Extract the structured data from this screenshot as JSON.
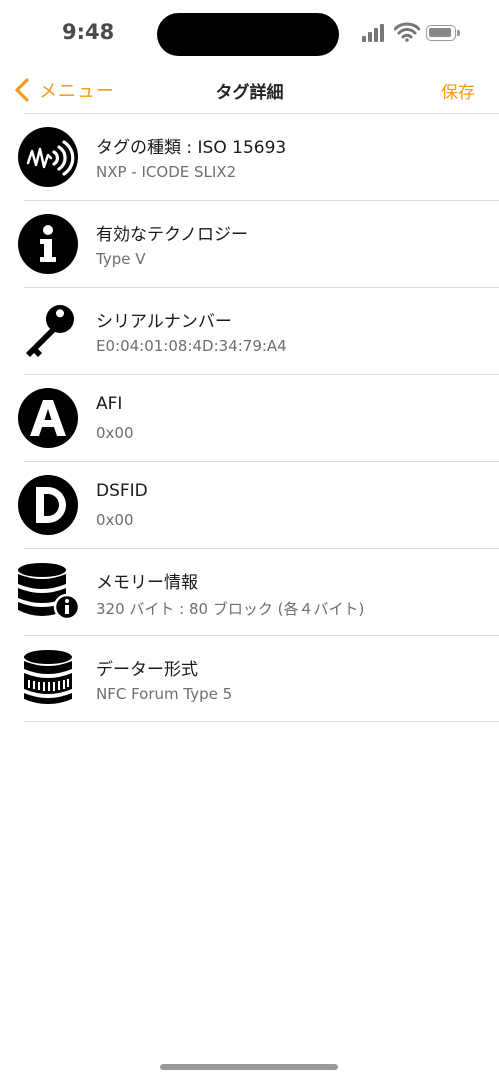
{
  "status_bar": {
    "time": "9:48"
  },
  "nav": {
    "back_label": "メニュー",
    "title": "タグ詳細",
    "save_label": "保存",
    "accent_color": "#f29a1a"
  },
  "rows": [
    {
      "icon": "nfc-signal-icon",
      "primary": "タグの種類 : ISO 15693",
      "secondary": "NXP - ICODE SLIX2"
    },
    {
      "icon": "info-icon",
      "primary": "有効なテクノロジー",
      "secondary": "Type V"
    },
    {
      "icon": "key-icon",
      "primary": "シリアルナンバー",
      "secondary": "E0:04:01:08:4D:34:79:A4"
    },
    {
      "icon": "letter-a-icon",
      "primary": "AFI",
      "secondary": "0x00"
    },
    {
      "icon": "letter-d-icon",
      "primary": "DSFID",
      "secondary": "0x00"
    },
    {
      "icon": "database-info-icon",
      "primary": "メモリー情報",
      "secondary": "320 バイト : 80 ブロック (各４バイト)"
    },
    {
      "icon": "database-icon",
      "primary": "データー形式",
      "secondary": "NFC Forum Type 5"
    }
  ]
}
